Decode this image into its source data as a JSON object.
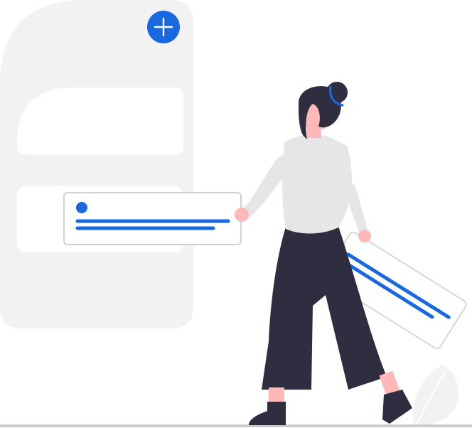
{
  "illustration": {
    "theme": "add-new-item",
    "colors": {
      "phone_panel": "#f2f2f2",
      "card_background": "#ffffff",
      "card_border": "#d6d6d6",
      "accent": "#1a68e0",
      "shirt": "#e6e6e6",
      "pants": "#2f2e41",
      "skin": "#ffb8b8",
      "hair": "#2f2e41",
      "ground": "#cccccc",
      "plant": "#f2f2f2"
    },
    "icons": {
      "add_button": "plus-icon"
    }
  }
}
